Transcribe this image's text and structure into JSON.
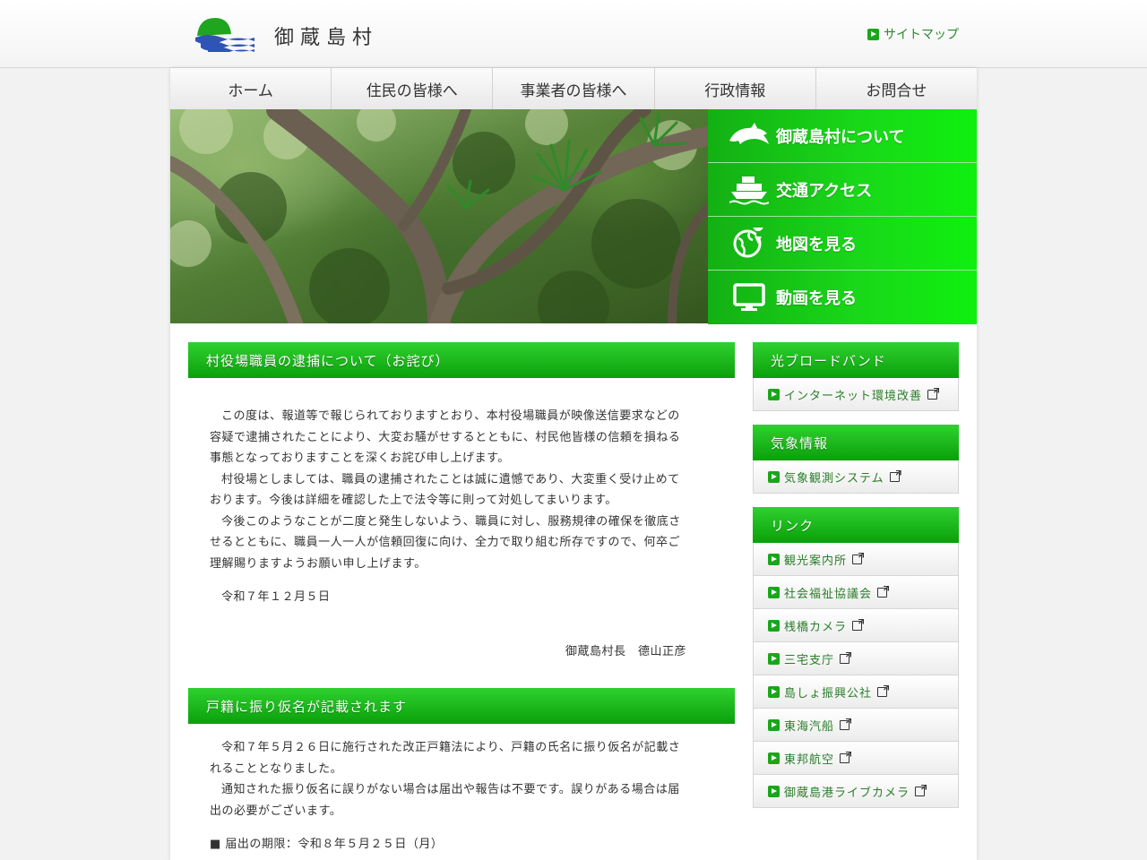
{
  "header": {
    "title": "御蔵島村",
    "sitemap_label": "サイトマップ"
  },
  "nav": {
    "items": [
      {
        "label": "ホーム"
      },
      {
        "label": "住民の皆様へ"
      },
      {
        "label": "事業者の皆様へ"
      },
      {
        "label": "行政情報"
      },
      {
        "label": "お問合せ"
      }
    ]
  },
  "quicklinks": {
    "items": [
      {
        "label": "御蔵島村について",
        "icon": "dolphin-icon"
      },
      {
        "label": "交通アクセス",
        "icon": "ship-icon"
      },
      {
        "label": "地図を見る",
        "icon": "globe-pin-icon"
      },
      {
        "label": "動画を見る",
        "icon": "monitor-icon"
      }
    ]
  },
  "articles": [
    {
      "title": "村役場職員の逮捕について（お詫び）",
      "paragraphs": [
        "この度は、報道等で報じられておりますとおり、本村役場職員が映像送信要求などの容疑で逮捕されたことにより、大変お騒がせするとともに、村民他皆様の信頼を損ねる事態となっておりますことを深くお詫び申し上げます。",
        "村役場としましては、職員の逮捕されたことは誠に遺憾であり、大変重く受け止めております。今後は詳細を確認した上で法令等に則って対処してまいります。",
        "今後このようなことが二度と発生しないよう、職員に対し、服務規律の確保を徹底させるとともに、職員一人一人が信頼回復に向け、全力で取り組む所存ですので、何卒ご理解賜りますようお願い申し上げます。"
      ],
      "date": "令和７年１２月５日",
      "signature": "御蔵島村長　德山正彦"
    },
    {
      "title": "戸籍に振り仮名が記載されます",
      "paragraphs": [
        "令和７年５月２６日に施行された改正戸籍法により、戸籍の氏名に振り仮名が記載されることとなりました。",
        "通知された振り仮名に誤りがない場合は届出や報告は不要です。誤りがある場合は届出の必要がございます。"
      ],
      "bullet": "■ 届出の期限：令和８年５月２５日（月）"
    }
  ],
  "sidebar": {
    "blocks": [
      {
        "title": "光ブロードバンド",
        "links": [
          {
            "label": "インターネット環境改善"
          }
        ]
      },
      {
        "title": "気象情報",
        "links": [
          {
            "label": "気象観測システム"
          }
        ]
      },
      {
        "title": "リンク",
        "links": [
          {
            "label": "観光案内所"
          },
          {
            "label": "社会福祉協議会"
          },
          {
            "label": "桟橋カメラ"
          },
          {
            "label": "三宅支庁"
          },
          {
            "label": "島しょ振興公社"
          },
          {
            "label": "東海汽船"
          },
          {
            "label": "東邦航空"
          },
          {
            "label": "御蔵島港ライブカメラ"
          }
        ]
      }
    ]
  },
  "colors": {
    "accent_green": "#0aa00a",
    "link_green": "#2a7d2a"
  }
}
